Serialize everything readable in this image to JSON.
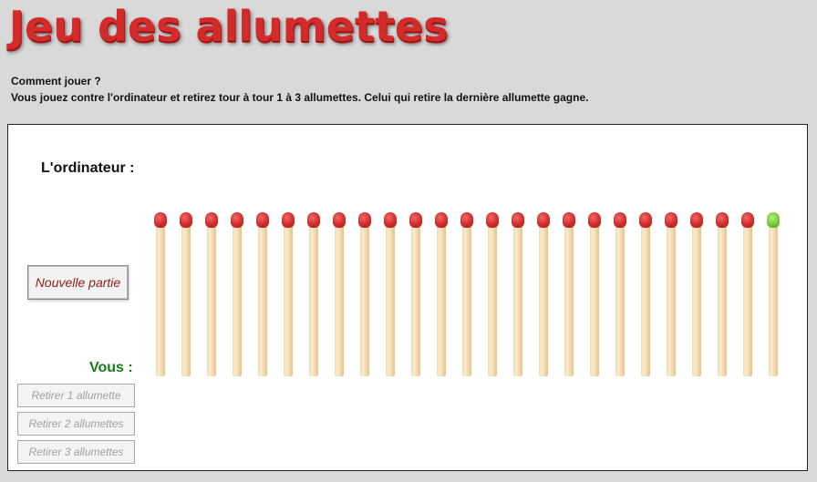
{
  "title": "Jeu des allumettes",
  "instructions": {
    "heading": "Comment jouer ?",
    "text": "Vous jouez contre l'ordinateur et retirez tour à tour 1 à 3 allumettes. Celui qui retire la dernière allumette gagne."
  },
  "board": {
    "computer_label": "L'ordinateur :",
    "player_label": "Vous :",
    "new_game_button": "Nouvelle partie",
    "take_buttons": [
      "Retirer 1 allumette",
      "Retirer 2 allumettes",
      "Retirer 3 allumettes"
    ],
    "take_buttons_enabled": false,
    "match_count": 25,
    "highlighted_match_index": 24
  },
  "colors": {
    "title": "#d32a2a",
    "player_label": "#1a7a1a",
    "match_head": "#d93333",
    "highlighted_match_head": "#7fd043"
  }
}
